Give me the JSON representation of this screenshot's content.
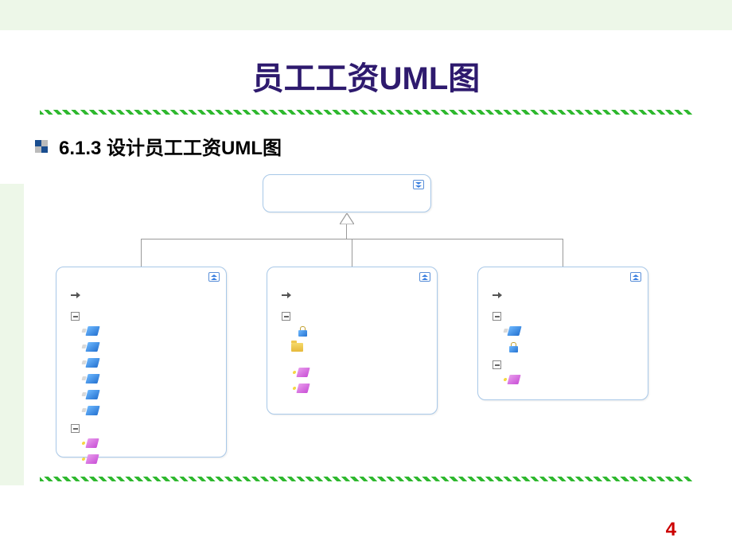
{
  "title": "员工工资UML图",
  "subtitle": "6.1.3 设计员工工资UML图",
  "page_number": "4",
  "uml": {
    "parent": {
      "toggle": "expand-down"
    },
    "children": [
      {
        "sections": [
          {
            "type": "attrs",
            "items": [
              "attr",
              "attr",
              "attr",
              "attr",
              "attr",
              "attr"
            ]
          },
          {
            "type": "methods",
            "items": [
              "method",
              "method"
            ]
          }
        ]
      },
      {
        "sections": [
          {
            "type": "attrs",
            "items": [
              "lock"
            ]
          },
          {
            "type": "folder",
            "items": [
              "folder"
            ]
          },
          {
            "type": "methods",
            "items": [
              "method",
              "method"
            ]
          }
        ]
      },
      {
        "sections": [
          {
            "type": "attrs",
            "items": [
              "attr",
              "lock"
            ]
          },
          {
            "type": "methods",
            "items": [
              "method"
            ]
          }
        ]
      }
    ]
  }
}
